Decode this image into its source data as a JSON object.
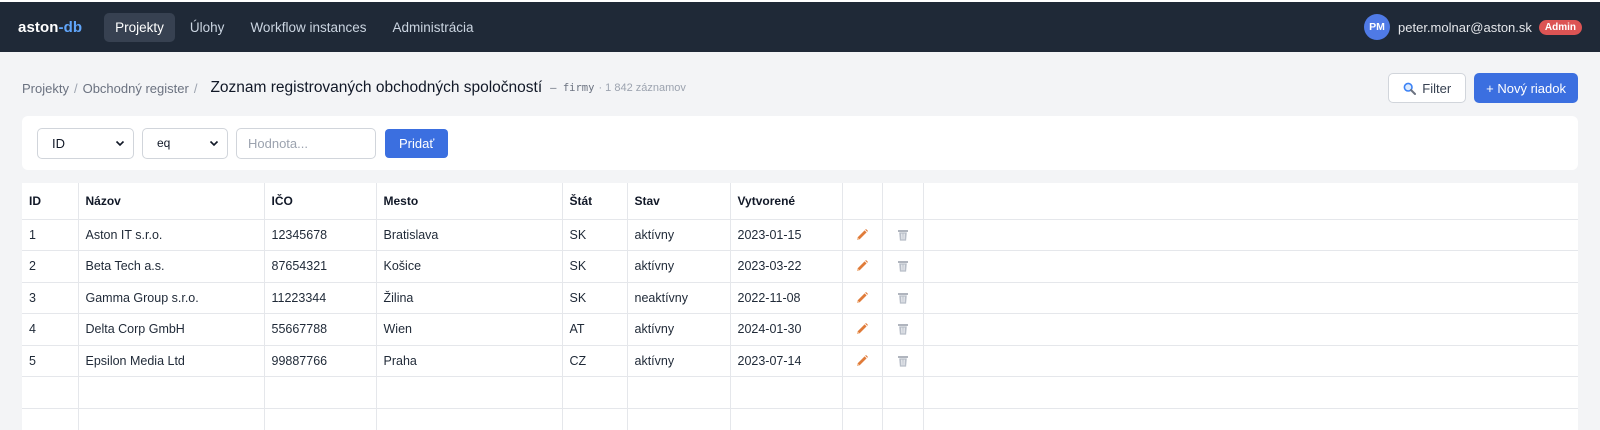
{
  "app": {
    "brand_main": "aston",
    "brand_accent": "-db"
  },
  "nav": {
    "items": [
      {
        "label": "Projekty",
        "active": true
      },
      {
        "label": "Úlohy",
        "active": false
      },
      {
        "label": "Workflow instances",
        "active": false
      },
      {
        "label": "Administrácia",
        "active": false
      }
    ]
  },
  "user": {
    "initials": "PM",
    "email": "peter.molnar@aston.sk",
    "role": "Admin"
  },
  "breadcrumb": {
    "items": [
      "Projekty",
      "Obchodný register"
    ],
    "separator": "/",
    "current": "Zoznam registrovaných obchodných spoločností",
    "table_code": "– firmy",
    "record_count": "· 1 842 záznamov"
  },
  "actions": {
    "filter_label": "Filter",
    "new_row_label": "+ Nový riadok"
  },
  "filter": {
    "field_value": "ID",
    "operator_value": "eq",
    "value_placeholder": "Hodnota...",
    "add_label": "Pridať"
  },
  "table": {
    "columns": [
      "ID",
      "Názov",
      "IČO",
      "Mesto",
      "Štát",
      "Stav",
      "Vytvorené"
    ],
    "rows": [
      [
        "1",
        "Aston IT s.r.o.",
        "12345678",
        "Bratislava",
        "SK",
        "aktívny",
        "2023-01-15"
      ],
      [
        "2",
        "Beta Tech a.s.",
        "87654321",
        "Košice",
        "SK",
        "aktívny",
        "2023-03-22"
      ],
      [
        "3",
        "Gamma Group s.r.o.",
        "11223344",
        "Žilina",
        "SK",
        "neaktívny",
        "2022-11-08"
      ],
      [
        "4",
        "Delta Corp GmbH",
        "55667788",
        "Wien",
        "AT",
        "aktívny",
        "2024-01-30"
      ],
      [
        "5",
        "Epsilon Media Ltd",
        "99887766",
        "Praha",
        "CZ",
        "aktívny",
        "2023-07-14"
      ]
    ]
  },
  "colors": {
    "navbar": "#1f2937",
    "brand_accent": "#60a5fa",
    "primary": "#3b6fe0",
    "badge": "#dc5454",
    "edit_icon": "#e07b39",
    "delete_icon": "#9ca3af"
  },
  "icons": {
    "search": "search-icon",
    "edit": "pencil-icon",
    "delete": "trash-icon",
    "dropdown": "chevron-down-icon"
  }
}
